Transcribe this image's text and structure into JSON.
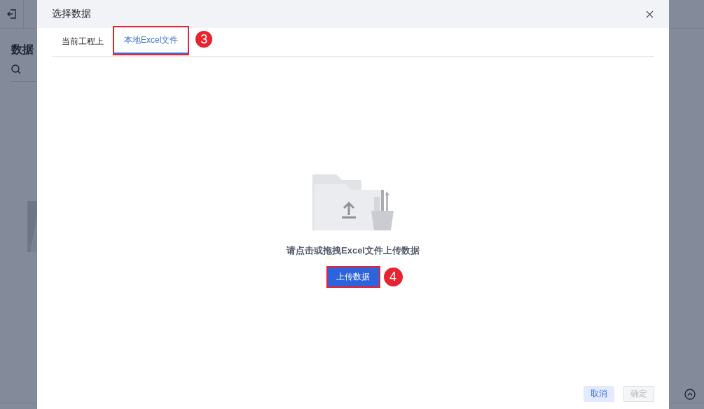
{
  "background": {
    "heading": "数据"
  },
  "dialog": {
    "title": "选择数据",
    "tabs": [
      {
        "label": "当前工程上",
        "selected": false
      },
      {
        "label": "本地Excel文件",
        "selected": true,
        "callout": "3"
      }
    ],
    "upload": {
      "hint": "请点击或拖拽Excel文件上传数据",
      "button": "上传数据",
      "callout": "4"
    },
    "buttons": [
      {
        "label": "取消",
        "disabled": false
      },
      {
        "label": "确定",
        "disabled": true
      }
    ]
  }
}
